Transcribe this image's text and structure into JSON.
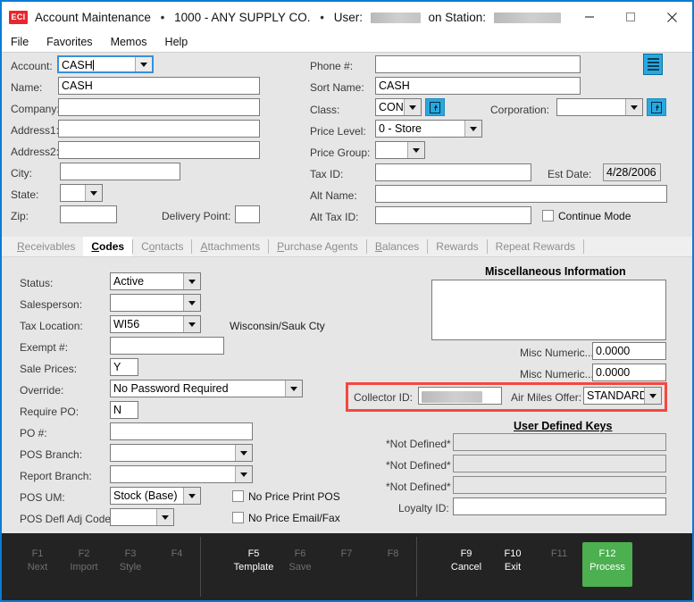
{
  "window": {
    "logo_text": "ECI",
    "title": "Account Maintenance",
    "sep": "•",
    "account_label": "1000 - ANY SUPPLY CO.",
    "user_label": "User:",
    "station_label": "on Station:",
    "minimize": "minimize-button",
    "maximize": "maximize-button",
    "close": "close-button"
  },
  "menu": {
    "items": [
      "File",
      "Favorites",
      "Memos",
      "Help"
    ]
  },
  "top_form": {
    "left": {
      "account_label": "Account:",
      "account_value": "CASH",
      "name_label": "Name:",
      "name_value": "CASH",
      "company_label": "Company:",
      "company_value": "",
      "address1_label": "Address1:",
      "address1_value": "",
      "address2_label": "Address2:",
      "address2_value": "",
      "city_label": "City:",
      "city_value": "",
      "state_label": "State:",
      "state_value": "",
      "zip_label": "Zip:",
      "zip_value": "",
      "delivery_point_label": "Delivery Point:",
      "delivery_point_value": ""
    },
    "right": {
      "phone_label": "Phone #:",
      "phone_value": "",
      "sort_name_label": "Sort Name:",
      "sort_name_value": "CASH",
      "class_label": "Class:",
      "class_value": "CON",
      "corporation_label": "Corporation:",
      "corporation_value": "",
      "price_level_label": "Price Level:",
      "price_level_value": "0 - Store",
      "price_group_label": "Price Group:",
      "price_group_value": "",
      "tax_id_label": "Tax ID:",
      "tax_id_value": "",
      "est_date_label": "Est Date:",
      "est_date_value": "4/28/2006",
      "alt_name_label": "Alt  Name:",
      "alt_name_value": "",
      "alt_tax_id_label": "Alt Tax ID:",
      "alt_tax_id_value": "",
      "continue_mode_label": "Continue Mode",
      "continue_mode_checked": false
    }
  },
  "tabs": [
    {
      "label": "Receivables",
      "accel": "R",
      "active": false
    },
    {
      "label": "Codes",
      "accel": "C",
      "active": true
    },
    {
      "label": "Contacts",
      "accel": "o",
      "active": false
    },
    {
      "label": "Attachments",
      "accel": "A",
      "active": false
    },
    {
      "label": "Purchase Agents",
      "accel": "P",
      "active": false
    },
    {
      "label": "Balances",
      "accel": "B",
      "active": false
    },
    {
      "label": "Rewards",
      "accel": "",
      "active": false
    },
    {
      "label": "Repeat Rewards",
      "accel": "",
      "active": false
    }
  ],
  "codes_tab": {
    "left": {
      "status_label": "Status:",
      "status_value": "Active",
      "salesperson_label": "Salesperson:",
      "salesperson_value": "",
      "tax_location_label": "Tax Location:",
      "tax_location_value": "WI56",
      "tax_location_desc": "Wisconsin/Sauk Cty",
      "exempt_label": "Exempt #:",
      "exempt_value": "",
      "sale_prices_label": "Sale Prices:",
      "sale_prices_value": "Y",
      "override_label": "Override:",
      "override_value": "No Password Required",
      "require_po_label": "Require PO:",
      "require_po_value": "N",
      "po_number_label": "PO #:",
      "po_number_value": "",
      "pos_branch_label": "POS Branch:",
      "pos_branch_value": "",
      "report_branch_label": "Report Branch:",
      "report_branch_value": "",
      "pos_um_label": "POS UM:",
      "pos_um_value": "Stock (Base)",
      "pos_defl_adj_label": "POS Defl Adj Code:",
      "pos_defl_adj_value": "",
      "no_price_print_pos_label": "No Price Print POS",
      "no_price_print_pos_checked": false,
      "no_price_email_fax_label": "No Price Email/Fax",
      "no_price_email_fax_checked": false
    },
    "right": {
      "misc_title": "Miscellaneous Information",
      "misc_memo_value": "",
      "misc_numeric1_label": "Misc Numeric...",
      "misc_numeric1_value": "0.0000",
      "misc_numeric2_label": "Misc Numeric...",
      "misc_numeric2_value": "0.0000",
      "collector_id_label": "Collector ID:",
      "collector_id_value": "",
      "air_miles_label": "Air Miles Offer:",
      "air_miles_value": "STANDARD",
      "udk_title": "User Defined Keys",
      "udk1_label": "*Not Defined*",
      "udk1_value": "",
      "udk2_label": "*Not Defined*",
      "udk2_value": "",
      "udk3_label": "*Not Defined*",
      "udk3_value": "",
      "loyalty_label": "Loyalty ID:",
      "loyalty_value": ""
    }
  },
  "function_bar": {
    "groups": [
      [
        {
          "key": "F1",
          "name": "Next",
          "state": "dim"
        },
        {
          "key": "F2",
          "name": "Import",
          "state": "dim"
        },
        {
          "key": "F3",
          "name": "Style",
          "state": "dim"
        },
        {
          "key": "F4",
          "name": "",
          "state": "dim"
        }
      ],
      [
        {
          "key": "F5",
          "name": "Template",
          "state": "on"
        },
        {
          "key": "F6",
          "name": "Save",
          "state": "dim"
        },
        {
          "key": "F7",
          "name": "",
          "state": "dim"
        },
        {
          "key": "F8",
          "name": "",
          "state": "dim"
        }
      ],
      [
        {
          "key": "F9",
          "name": "Cancel",
          "state": "on"
        },
        {
          "key": "F10",
          "name": "Exit",
          "state": "on"
        },
        {
          "key": "F11",
          "name": "",
          "state": "dim"
        },
        {
          "key": "F12",
          "name": "Process",
          "state": "green"
        }
      ]
    ]
  },
  "colors": {
    "window_border": "#0a7cd4",
    "accent_blue": "#29a8e0",
    "highlight_red": "#f4483f",
    "process_green": "#4caf50",
    "logo_red": "#e8262d",
    "form_bg": "#e6e6e6",
    "fnbar_bg": "#232323"
  }
}
